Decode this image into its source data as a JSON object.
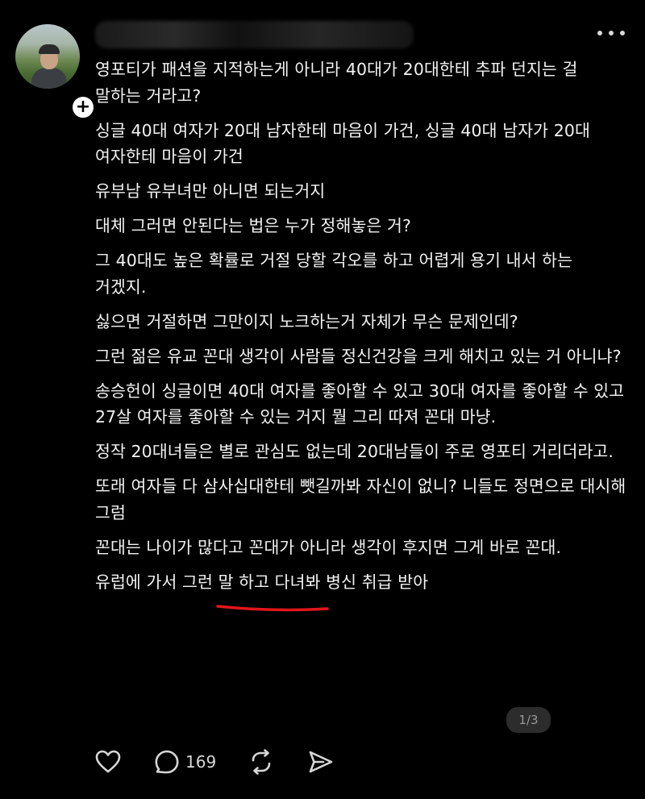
{
  "post": {
    "username": "",
    "paragraphs": [
      "영포티가 패션을 지적하는게 아니라 40대가 20대한테 추파 던지는 걸 말하는 거라고?",
      "싱글 40대 여자가 20대 남자한테 마음이 가건, 싱글 40대 남자가 20대 여자한테 마음이 가건",
      "유부남 유부녀만 아니면 되는거지",
      "대체 그러면 안된다는 법은 누가 정해놓은 거?",
      "그 40대도 높은 확률로 거절 당할 각오를 하고 어렵게 용기 내서 하는 거겠지.",
      "싫으면 거절하면 그만이지 노크하는거 자체가 무슨 문제인데?",
      "그런 젊은 유교 꼰대 생각이 사람들 정신건강을 크게 해치고 있는 거 아니냐?",
      "송승헌이 싱글이면 40대 여자를 좋아할 수 있고 30대 여자를 좋아할 수 있고 27살 여자를 좋아할 수 있는 거지 뭘 그리 따져 꼰대 마냥.",
      "정작 20대녀들은 별로 관심도 없는데 20대남들이 주로 영포티 거리더라고.",
      "또래 여자들 다 삼사십대한테 뺏길까봐 자신이 없니? 니들도 정면으로 대시해 그럼",
      "꼰대는 나이가 많다고 꼰대가 아니라 생각이 후지면 그게 바로 꼰대.",
      "유럽에 가서 그런 말 하고 다녀봐 병신 취급 받아"
    ],
    "page_indicator": "1/3",
    "comment_count": "169",
    "underline_color": "#e3161b"
  },
  "icons": {
    "avatar": "avatar-photo",
    "follow": "plus-icon",
    "more": "more-horizontal-icon",
    "like": "heart-icon",
    "comment": "comment-bubble-icon",
    "repost": "repost-icon",
    "share": "send-icon"
  }
}
